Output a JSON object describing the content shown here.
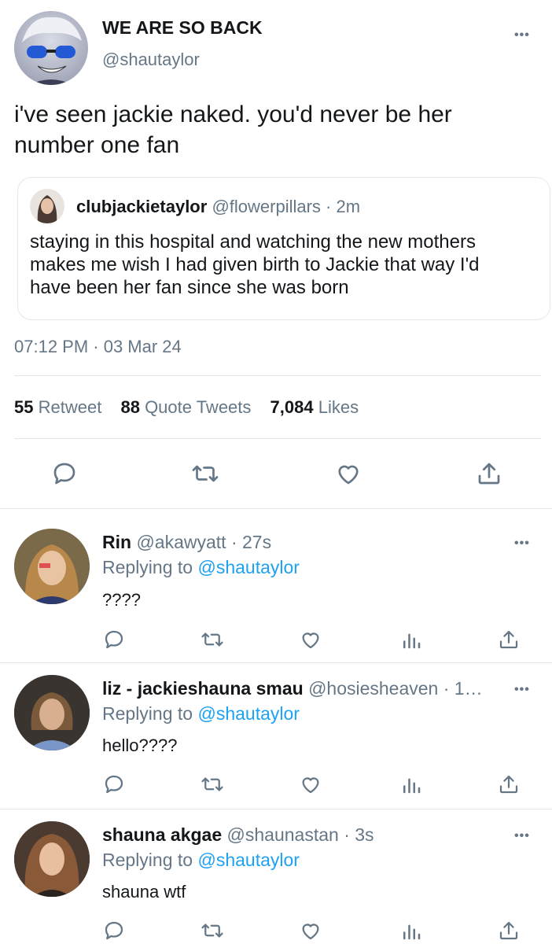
{
  "tweet": {
    "display_name": "WE ARE SO BACK",
    "handle": "@shautaylor",
    "text_line1": "i've seen jackie naked. you'd never be her",
    "text_line2": "number one fan",
    "quote": {
      "name": "clubjackietaylor",
      "handle_time": "@flowerpillars · 2m",
      "line1": "staying in this hospital and watching the new mothers",
      "line2": "makes me wish I had given birth to Jackie that way I'd",
      "line3": "have been her fan since she was born"
    },
    "timestamp": "07:12 PM · 03 Mar 24",
    "stats": {
      "retweets_count": "55",
      "retweets_label": "Retweet",
      "quotes_count": "88",
      "quotes_label": "Quote Tweets",
      "likes_count": "7,084",
      "likes_label": "Likes"
    }
  },
  "replies": [
    {
      "name": "Rin",
      "handle_time": "@akawyatt · 27s",
      "replying_prefix": "Replying to",
      "replying_handle": "@shautaylor",
      "text": "????"
    },
    {
      "name": "liz - jackieshauna smau",
      "handle_time": "@hosiesheaven · 1…",
      "replying_prefix": "Replying to",
      "replying_handle": "@shautaylor",
      "text": "hello????"
    },
    {
      "name": "shauna akgae",
      "handle_time": "@shaunastan · 3s",
      "replying_prefix": "Replying to",
      "replying_handle": "@shautaylor",
      "text": "shauna wtf"
    }
  ],
  "more_glyph": "•••",
  "icons": {
    "reply": "reply-icon",
    "retweet": "retweet-icon",
    "like": "heart-icon",
    "share": "share-icon",
    "analytics": "analytics-icon"
  },
  "colors": {
    "link": "#1da1f2",
    "secondary_text": "#657786",
    "divider": "#e1e8ed"
  }
}
